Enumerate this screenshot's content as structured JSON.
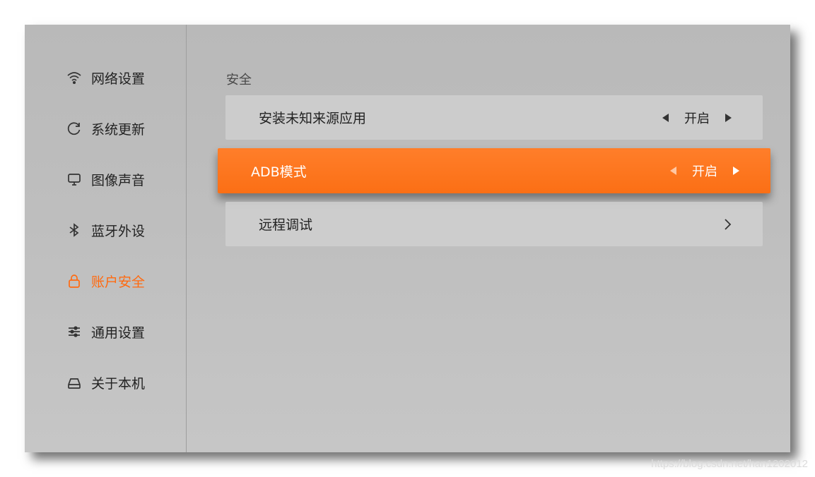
{
  "sidebar": {
    "items": [
      {
        "label": "网络设置",
        "icon": "wifi-icon"
      },
      {
        "label": "系统更新",
        "icon": "refresh-icon"
      },
      {
        "label": "图像声音",
        "icon": "monitor-icon"
      },
      {
        "label": "蓝牙外设",
        "icon": "bluetooth-icon"
      },
      {
        "label": "账户安全",
        "icon": "lock-icon",
        "active": true
      },
      {
        "label": "通用设置",
        "icon": "sliders-icon"
      },
      {
        "label": "关于本机",
        "icon": "drive-icon"
      }
    ]
  },
  "main": {
    "section_title": "安全",
    "rows": [
      {
        "label": "安装未知来源应用",
        "value": "开启"
      },
      {
        "label": "ADB模式",
        "value": "开启"
      },
      {
        "label": "远程调试"
      }
    ]
  },
  "watermark": "https://blog.csdn.net/han1202012",
  "colors": {
    "accent": "#ff6a10",
    "background": "#bebebe"
  }
}
